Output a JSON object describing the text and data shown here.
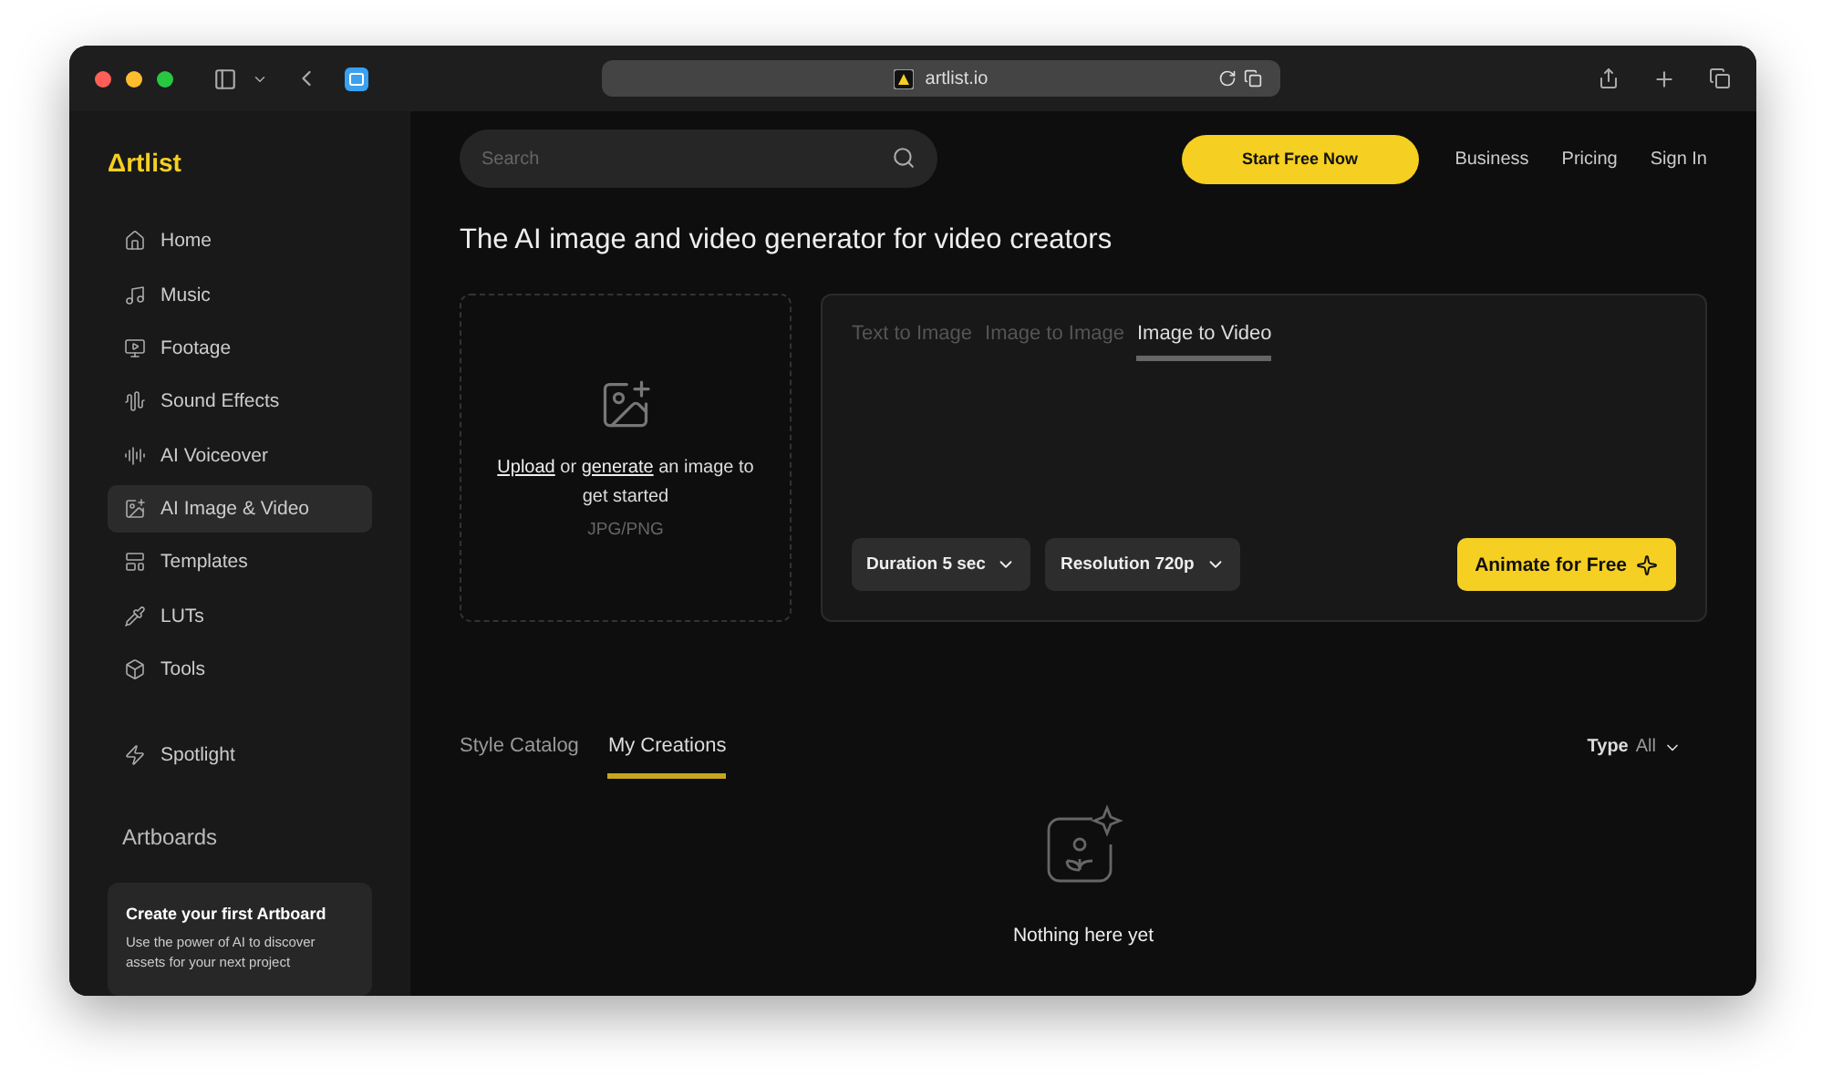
{
  "browser": {
    "url": "artlist.io"
  },
  "sidebar": {
    "logo": "Δrtlist",
    "items": [
      {
        "label": "Home",
        "kind": "home",
        "selected": false
      },
      {
        "label": "Music",
        "kind": "music",
        "selected": false
      },
      {
        "label": "Footage",
        "kind": "footage",
        "selected": false
      },
      {
        "label": "Sound Effects",
        "kind": "sfx",
        "selected": false
      },
      {
        "label": "AI Voiceover",
        "kind": "voice",
        "selected": false
      },
      {
        "label": "AI Image & Video",
        "kind": "image",
        "selected": true
      },
      {
        "label": "Templates",
        "kind": "templates",
        "selected": false
      },
      {
        "label": "LUTs",
        "kind": "luts",
        "selected": false
      },
      {
        "label": "Tools",
        "kind": "tools",
        "selected": false
      }
    ],
    "spotlight": "Spotlight",
    "artboards_heading": "Artboards",
    "card": {
      "title": "Create your first Artboard",
      "text": "Use the power of AI to discover assets for your next project"
    }
  },
  "header": {
    "search": {
      "placeholder": "Search"
    },
    "cta": "Start Free Now",
    "links": [
      "Business",
      "Pricing",
      "Sign In"
    ]
  },
  "headline": "The AI image and video generator for video creators",
  "upload": {
    "link_1": "Upload",
    "middle": " or ",
    "link_2": "generate",
    "rest": " an image to get started",
    "formats": "JPG/PNG"
  },
  "generator": {
    "tabs": [
      {
        "label": "Text to Image",
        "selected": false
      },
      {
        "label": "Image to Image",
        "selected": false
      },
      {
        "label": "Image to Video",
        "selected": true
      }
    ],
    "options": [
      "Duration 5 sec",
      "Resolution 720p"
    ],
    "action": "Animate for Free"
  },
  "gallery": {
    "tabs": [
      {
        "label": "Style Catalog",
        "selected": false
      },
      {
        "label": "My Creations",
        "selected": true
      }
    ],
    "filter_label": "Type",
    "filter_value": "All",
    "empty": "Nothing here yet"
  }
}
